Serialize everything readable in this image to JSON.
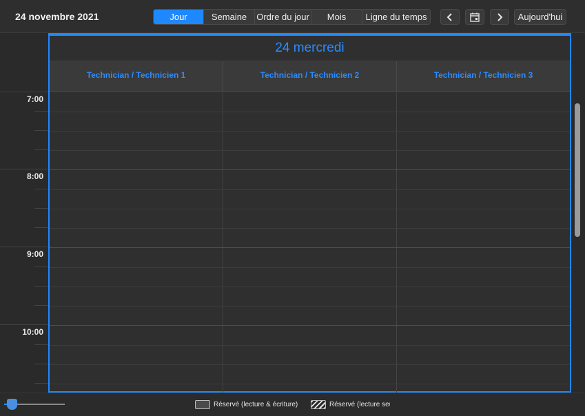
{
  "header": {
    "date_title": "24 novembre 2021",
    "views": [
      {
        "label": "Jour",
        "active": true
      },
      {
        "label": "Semaine",
        "active": false
      },
      {
        "label": "Ordre du jour",
        "active": false
      },
      {
        "label": "Mois",
        "active": false
      },
      {
        "label": "Ligne du temps",
        "active": false
      }
    ],
    "prev_icon": "chevron-left-icon",
    "calendar_icon": "calendar-icon",
    "next_icon": "chevron-right-icon",
    "today_label": "Aujourd'hui"
  },
  "day": {
    "title": "24 mercredi",
    "resources": [
      "Technician / Technicien 1",
      "Technician / Technicien 2",
      "Technician / Technicien 3"
    ]
  },
  "times": [
    "7:00",
    "8:00",
    "9:00",
    "10:00"
  ],
  "footer": {
    "legend": [
      {
        "label": "Réservé (lecture & écriture)",
        "pattern": "solid"
      },
      {
        "label": "Réservé (lecture seule)",
        "pattern": "hatch"
      }
    ]
  },
  "colors": {
    "accent": "#1e88ff",
    "background": "#2b2b2b"
  }
}
